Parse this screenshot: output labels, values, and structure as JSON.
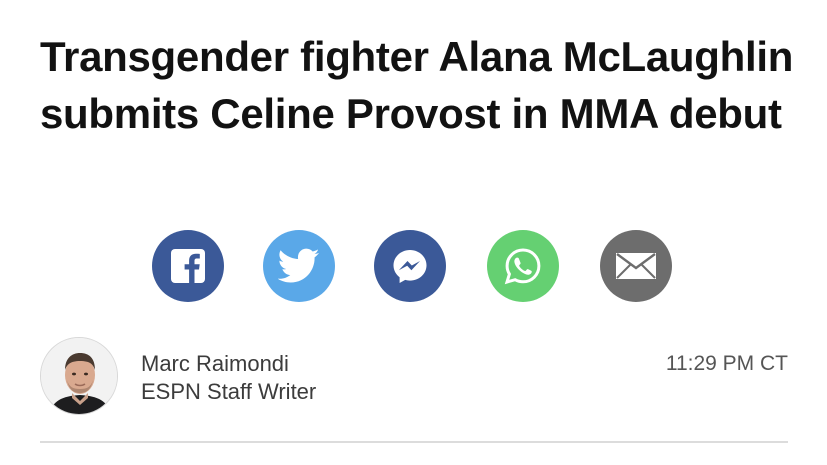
{
  "article": {
    "headline": "Transgender fighter Alana McLaughlin submits Celine Provost in MMA debut"
  },
  "share": {
    "buttons": [
      {
        "name": "facebook",
        "icon": "facebook-icon",
        "color": "#3b5998"
      },
      {
        "name": "twitter",
        "icon": "twitter-icon",
        "color": "#55acee"
      },
      {
        "name": "messenger",
        "icon": "messenger-icon",
        "color": "#3b5998"
      },
      {
        "name": "whatsapp",
        "icon": "whatsapp-icon",
        "color": "#65d072"
      },
      {
        "name": "email",
        "icon": "email-icon",
        "color": "#6d6d6d"
      }
    ]
  },
  "byline": {
    "author_name": "Marc Raimondi",
    "author_role": "ESPN Staff Writer",
    "timestamp": "11:29 PM CT"
  }
}
